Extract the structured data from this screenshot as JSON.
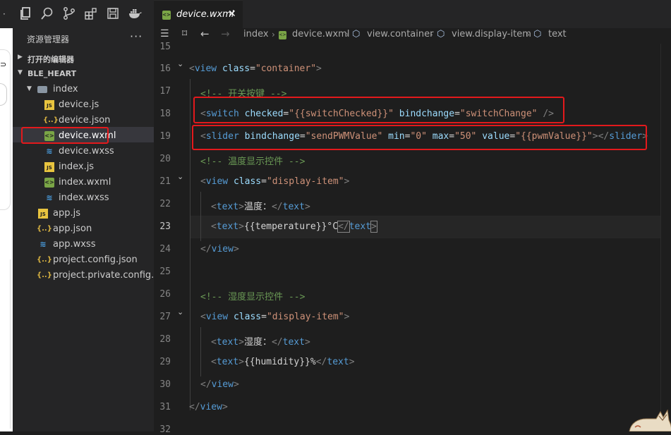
{
  "sidebar": {
    "title": "资源管理器",
    "more": "···",
    "open_editors": "打开的编辑器",
    "project": "BLE_HEART",
    "files": [
      {
        "name": "index",
        "type": "folder"
      },
      {
        "name": "device.js",
        "type": "js"
      },
      {
        "name": "device.json",
        "type": "json"
      },
      {
        "name": "device.wxml",
        "type": "wxml",
        "selected": true
      },
      {
        "name": "device.wxss",
        "type": "wxss"
      },
      {
        "name": "index.js",
        "type": "js"
      },
      {
        "name": "index.wxml",
        "type": "wxml"
      },
      {
        "name": "index.wxss",
        "type": "wxss"
      },
      {
        "name": "app.js",
        "type": "js"
      },
      {
        "name": "app.json",
        "type": "json"
      },
      {
        "name": "app.wxss",
        "type": "wxss"
      },
      {
        "name": "project.config.json",
        "type": "json"
      },
      {
        "name": "project.private.config.js...",
        "type": "json"
      }
    ]
  },
  "tab": {
    "label": "device.wxml",
    "close": "✕"
  },
  "breadcrumb": [
    "index",
    "device.wxml",
    "view.container",
    "view.display-item",
    "text"
  ],
  "editor": {
    "current_line": "23",
    "lines": [
      {
        "n": "15"
      },
      {
        "n": "16"
      },
      {
        "n": "17"
      },
      {
        "n": "18"
      },
      {
        "n": "19"
      },
      {
        "n": "20"
      },
      {
        "n": "21"
      },
      {
        "n": "22"
      },
      {
        "n": "23"
      },
      {
        "n": "24"
      },
      {
        "n": "25"
      },
      {
        "n": "26"
      },
      {
        "n": "27"
      },
      {
        "n": "28"
      },
      {
        "n": "29"
      },
      {
        "n": "30"
      },
      {
        "n": "31"
      },
      {
        "n": "32"
      }
    ],
    "code": {
      "l16": {
        "tag": "view",
        "attr": "class",
        "val": "\"container\""
      },
      "l17": {
        "comment": "<!-- 开关按键 -->"
      },
      "l18": {
        "tag": "switch",
        "a1": "checked",
        "v1": "\"{{switchChecked}}\"",
        "a2": "bindchange",
        "v2": "\"switchChange\"",
        "end": "/>"
      },
      "l19": {
        "tag": "slider",
        "a1": "bindchange",
        "v1": "\"sendPWMValue\"",
        "a2": "min",
        "v2": "\"0\"",
        "a3": "max",
        "v3": "\"50\"",
        "a4": "value",
        "v4": "\"{{pwmValue}}\"",
        "close": "slider"
      },
      "l20": {
        "comment": "<!-- 温度显示控件 -->"
      },
      "l21": {
        "tag": "view",
        "attr": "class",
        "val": "\"display-item\""
      },
      "l22": {
        "tag": "text",
        "text": "温度：",
        "close": "text"
      },
      "l23": {
        "tag": "text",
        "text": "{{temperature}}°C",
        "close": "text"
      },
      "l24": {
        "close": "view"
      },
      "l26": {
        "comment": "<!-- 湿度显示控件 -->"
      },
      "l27": {
        "tag": "view",
        "attr": "class",
        "val": "\"display-item\""
      },
      "l28": {
        "tag": "text",
        "text": "湿度：",
        "close": "text"
      },
      "l29": {
        "tag": "text",
        "text": "{{humidity}}%",
        "close": "text"
      },
      "l30": {
        "close": "view"
      },
      "l31": {
        "close": "view"
      }
    }
  },
  "colors": {
    "highlight_box": "#e3191c",
    "tag": "#569cd6",
    "attribute": "#9cdcfe",
    "string": "#ce9178",
    "comment": "#6a9955"
  }
}
